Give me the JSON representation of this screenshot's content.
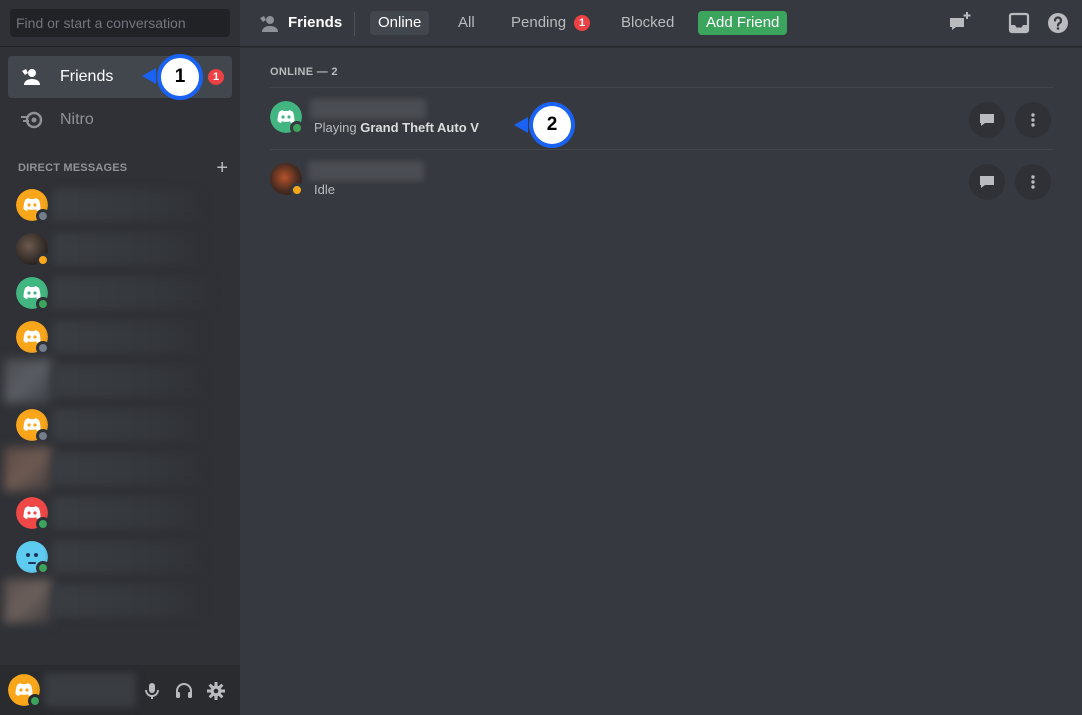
{
  "search": {
    "placeholder": "Find or start a conversation"
  },
  "sidebar": {
    "nav": [
      {
        "label": "Friends",
        "icon": "friends-icon",
        "badge": "1",
        "selected": true
      },
      {
        "label": "Nitro",
        "icon": "nitro-icon"
      }
    ],
    "dm_header": "DIRECT MESSAGES",
    "dm_add_icon": "plus-icon",
    "dms": [
      {
        "avatar": "discord-logo-orange",
        "status": "offline"
      },
      {
        "avatar": "photo",
        "status": "idle"
      },
      {
        "avatar": "discord-logo-green",
        "status": "online"
      },
      {
        "avatar": "discord-logo-orange",
        "status": "offline"
      },
      {
        "avatar": "photo",
        "status": "none"
      },
      {
        "avatar": "discord-logo-orange",
        "status": "offline"
      },
      {
        "avatar": "photo",
        "status": "none"
      },
      {
        "avatar": "discord-logo-red",
        "status": "online"
      },
      {
        "avatar": "emoji-face-blue",
        "status": "online"
      },
      {
        "avatar": "photo",
        "status": "none"
      }
    ]
  },
  "user_panel": {
    "icons": [
      "microphone-icon",
      "headphones-icon",
      "settings-gear-icon"
    ]
  },
  "topbar": {
    "title": "Friends",
    "title_icon": "friends-icon",
    "tabs": [
      {
        "label": "Online",
        "selected": true
      },
      {
        "label": "All"
      },
      {
        "label": "Pending",
        "badge": "1"
      },
      {
        "label": "Blocked"
      },
      {
        "label": "Add Friend",
        "style": "green"
      }
    ],
    "right_icons": [
      "new-group-dm-icon",
      "inbox-icon",
      "help-icon"
    ]
  },
  "friends_list": {
    "section_title": "ONLINE — 2",
    "friends": [
      {
        "avatar": "discord-logo-green",
        "status": "online",
        "activity_prefix": "Playing ",
        "activity_game": "Grand Theft Auto V"
      },
      {
        "avatar": "photo",
        "status": "idle",
        "activity_prefix": "Idle",
        "activity_game": ""
      }
    ]
  },
  "callouts": [
    "1",
    "2"
  ],
  "colors": {
    "sidebar_bg": "#2f3136",
    "main_bg": "#36393f",
    "online": "#3ba55d",
    "idle": "#faa81a",
    "offline": "#747f8d",
    "badge_red": "#ed4245",
    "callout_blue": "#1a62f3",
    "add_friend_green": "#3ba55d"
  }
}
